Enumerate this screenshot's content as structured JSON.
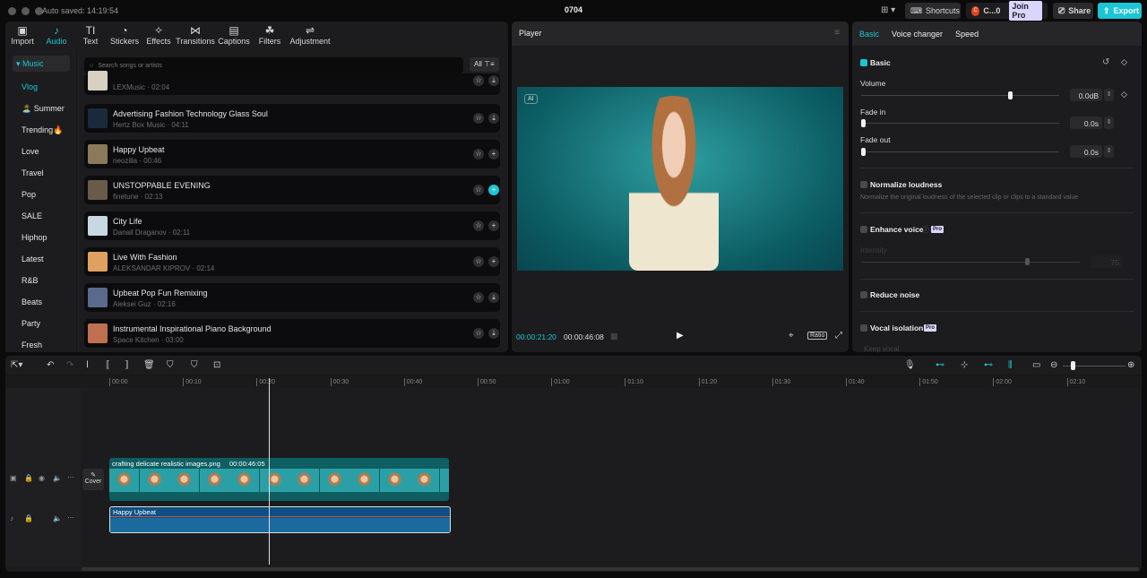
{
  "titlebar": {
    "autosave": "Auto saved: 14:19:54",
    "title": "0704",
    "shortcuts": "Shortcuts",
    "account": "C...0",
    "join_pro": "Join Pro",
    "share": "Share",
    "export": "Export"
  },
  "toolbar": [
    {
      "label": "Import",
      "icon": "▣"
    },
    {
      "label": "Audio",
      "icon": "♪",
      "active": true
    },
    {
      "label": "Text",
      "icon": "TI"
    },
    {
      "label": "Stickers",
      "icon": "◔"
    },
    {
      "label": "Effects",
      "icon": "✧"
    },
    {
      "label": "Transitions",
      "icon": "⋈"
    },
    {
      "label": "Captions",
      "icon": "▤"
    },
    {
      "label": "Filters",
      "icon": "☘"
    },
    {
      "label": "Adjustment",
      "icon": "⇌"
    }
  ],
  "categories": {
    "header": "▾ Music",
    "items": [
      "Vlog",
      "🏝️ Summer",
      "Trending🔥",
      "Love",
      "Travel",
      "Pop",
      "SALE",
      "Hiphop",
      "Latest",
      "R&B",
      "Beats",
      "Party",
      "Fresh"
    ]
  },
  "search": {
    "placeholder": "Search songs or artists",
    "filter": "All ⊤≡"
  },
  "songs": [
    {
      "title": "",
      "meta": "LEXMusic · 02:04",
      "action": "download"
    },
    {
      "title": "Advertising Fashion Technology Glass Soul",
      "meta": "Hertz Box Music · 04:11",
      "action": "download"
    },
    {
      "title": "Happy Upbeat",
      "meta": "neozilla · 00:46",
      "action": "add"
    },
    {
      "title": "UNSTOPPABLE EVENING",
      "meta": "finetune · 02:13",
      "action": "add-active"
    },
    {
      "title": "City Life",
      "meta": "Danail Draganov · 02:11",
      "action": "add"
    },
    {
      "title": "Live With Fashion",
      "meta": "ALEKSANDAR KIPROV · 02:14",
      "action": "add"
    },
    {
      "title": "Upbeat Pop Fun Remixing",
      "meta": "Aleksei Guz · 02:16",
      "action": "download"
    },
    {
      "title": "Instrumental Inspirational Piano Background",
      "meta": "Space Kitchen · 03:00",
      "action": "download"
    }
  ],
  "player": {
    "title": "Player",
    "ai_badge": "AI",
    "current": "00:00:21:20",
    "total": "00:00:46:08",
    "ratio": "Ratio"
  },
  "right": {
    "tabs": [
      "Basic",
      "Voice changer",
      "Speed"
    ],
    "basic": "Basic",
    "volume_label": "Volume",
    "volume": "0.0dB",
    "volume_fraction": 0.74,
    "fade_in_label": "Fade in",
    "fade_in": "0.0s",
    "fade_out_label": "Fade out",
    "fade_out": "0.0s",
    "normalize": "Normalize loudness",
    "normalize_desc": "Normalize the original loudness of the selected clip or clips to a standard value",
    "enhance": "Enhance voice",
    "pro": "Pro",
    "intensity_label": "Intensity",
    "intensity": "75",
    "reduce": "Reduce noise",
    "vocal": "Vocal isolation",
    "keep_vocal": "Keep vocal"
  },
  "timeline": {
    "ticks": [
      "00:00",
      "00:10",
      "00:20",
      "00:30",
      "00:40",
      "00:50",
      "01:00",
      "01:10",
      "01:20",
      "01:30",
      "01:40",
      "01:50",
      "02:00",
      "02:10"
    ],
    "video_clip": "crafting delicate realistic images.png",
    "video_duration": "00:00:46:05",
    "audio_clip": "Happy Upbeat",
    "cover": "Cover"
  }
}
